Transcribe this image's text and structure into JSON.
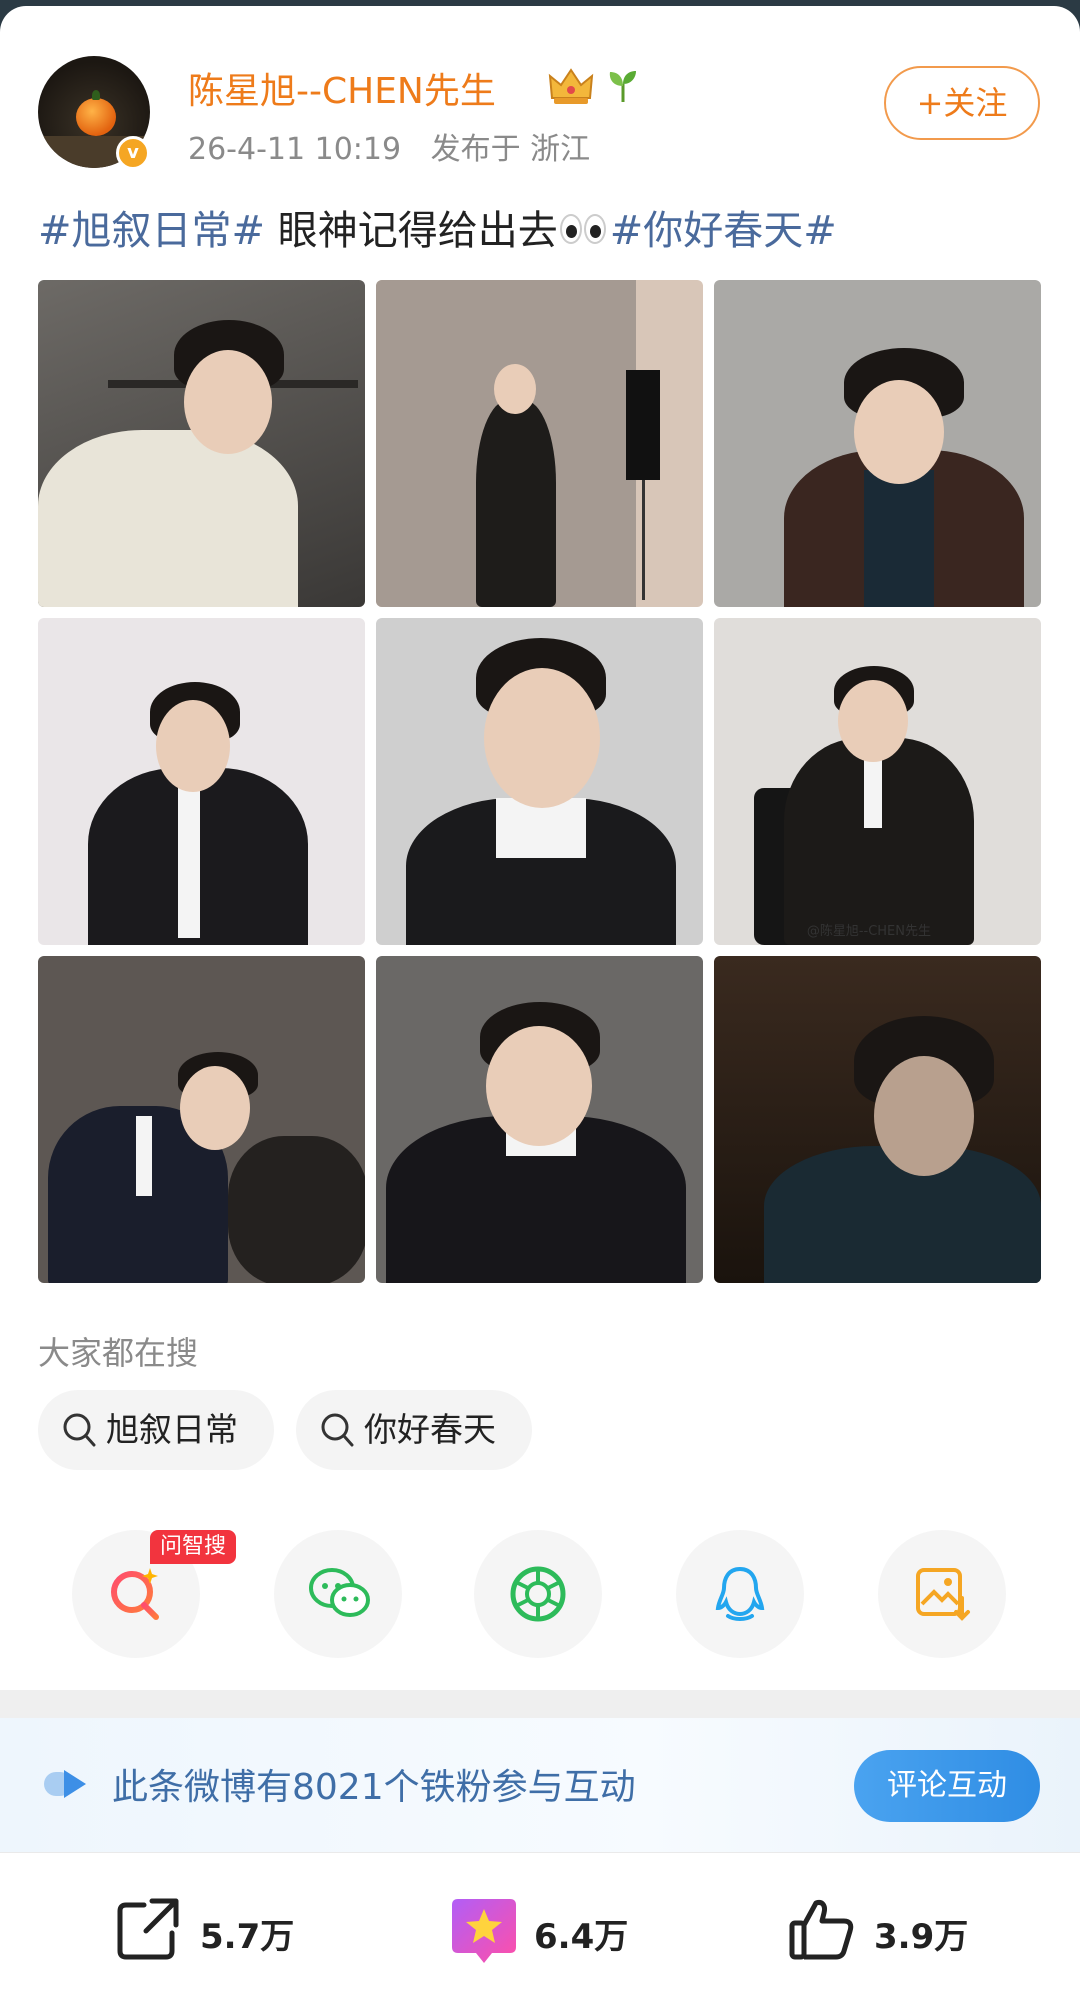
{
  "post": {
    "username": "陈星旭--CHEN先生",
    "timestamp": "26-4-11 10:19",
    "location": "发布于 浙江",
    "follow_label": "+关注",
    "text_tag1": "#旭叙日常#",
    "text_body": " 眼神记得给出去",
    "text_tag2": "#你好春天#",
    "photo_watermark": "@陈星旭--CHEN先生"
  },
  "search": {
    "title": "大家都在搜",
    "chips": [
      "旭叙日常",
      "你好春天"
    ]
  },
  "share": {
    "ai_badge": "问智搜",
    "icons": [
      "ai-search-icon",
      "wechat-icon",
      "moments-icon",
      "qq-icon",
      "save-image-icon"
    ]
  },
  "banner": {
    "text": "此条微博有8021个铁粉参与互动",
    "button": "评论互动"
  },
  "actions": {
    "repost_count": "5.7万",
    "favorite_count": "6.4万",
    "like_count": "3.9万"
  },
  "colors": {
    "username": "#ee7b1a",
    "hashtag": "#4a6a9c",
    "banner_text": "#3f6ea7",
    "button_blue": "#2f8de4",
    "ai_badge": "#f2343e"
  }
}
